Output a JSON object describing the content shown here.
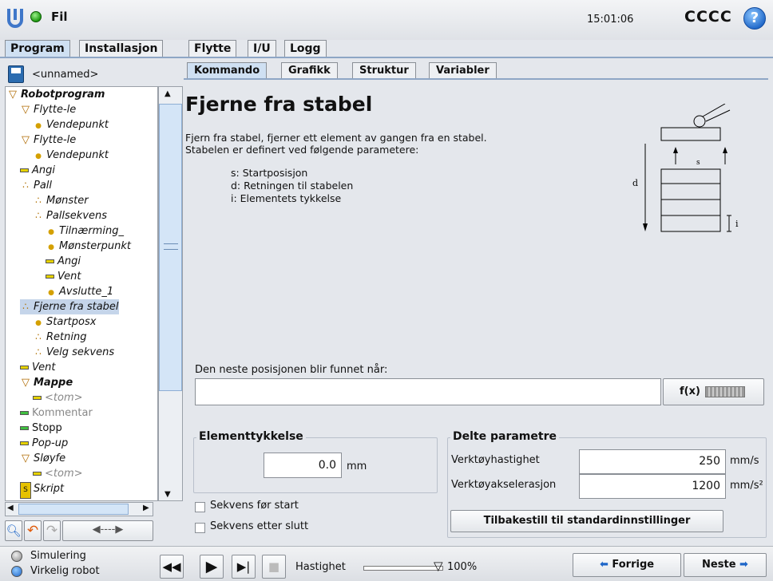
{
  "header": {
    "file_menu": "Fil",
    "clock": "15:01:06",
    "robot_name": "CCCC",
    "help": "?"
  },
  "main_tabs": [
    "Program",
    "Installasjon",
    "Flytte",
    "I/U",
    "Logg"
  ],
  "program": {
    "name": "<unnamed>"
  },
  "tree": [
    {
      "label": "Robotprogram",
      "icon": "triangle",
      "level": 0,
      "bold": true
    },
    {
      "label": "Flytte-le",
      "icon": "triangle",
      "level": 1
    },
    {
      "label": "Vendepunkt",
      "icon": "point",
      "level": 2
    },
    {
      "label": "Flytte-le",
      "icon": "triangle",
      "level": 1
    },
    {
      "label": "Vendepunkt",
      "icon": "point",
      "level": 2
    },
    {
      "label": "Angi",
      "icon": "line",
      "level": 1
    },
    {
      "label": "Pall",
      "icon": "dots",
      "level": 1
    },
    {
      "label": "Mønster",
      "icon": "dots",
      "level": 2
    },
    {
      "label": "Pallsekvens",
      "icon": "dots",
      "level": 2
    },
    {
      "label": "Tilnærming_",
      "icon": "point",
      "level": 3
    },
    {
      "label": "Mønsterpunkt",
      "icon": "point",
      "level": 3
    },
    {
      "label": "Angi",
      "icon": "line",
      "level": 3
    },
    {
      "label": "Vent",
      "icon": "line",
      "level": 3
    },
    {
      "label": "Avslutte_1",
      "icon": "point",
      "level": 3
    },
    {
      "label": "Fjerne fra stabel",
      "icon": "dots",
      "level": 1,
      "selected": true
    },
    {
      "label": "Startposx",
      "icon": "point",
      "level": 2
    },
    {
      "label": "Retning",
      "icon": "dots",
      "level": 2
    },
    {
      "label": "Velg sekvens",
      "icon": "dots",
      "level": 2
    },
    {
      "label": "Vent",
      "icon": "line",
      "level": 1
    },
    {
      "label": "Mappe",
      "icon": "triangle",
      "level": 1,
      "bold": true
    },
    {
      "label": "<tom>",
      "icon": "line",
      "level": 2,
      "grey": true
    },
    {
      "label": "Kommentar",
      "icon": "linegreen",
      "level": 1,
      "grey": true,
      "normal": true
    },
    {
      "label": "Stopp",
      "icon": "linegreen",
      "level": 1,
      "normal": true
    },
    {
      "label": "Pop-up",
      "icon": "line",
      "level": 1
    },
    {
      "label": "Sløyfe",
      "icon": "triangle",
      "level": 1
    },
    {
      "label": "<tom>",
      "icon": "line",
      "level": 2,
      "grey": true
    },
    {
      "label": "Skript",
      "icon": "script",
      "level": 1
    }
  ],
  "sub_tabs": [
    "Kommando",
    "Grafikk",
    "Struktur",
    "Variabler"
  ],
  "command": {
    "title": "Fjerne fra stabel",
    "desc1": "Fjern fra stabel, fjerner ett element av gangen fra en stabel.",
    "desc2": "Stabelen er definert ved følgende parametere:",
    "param_s": "s: Startposisjon",
    "param_d": "d: Retningen til stabelen",
    "param_i": "i: Elementets tykkelse",
    "next_label": "Den neste posisjonen blir funnet når:",
    "expression": "",
    "fx_label": "f(x)"
  },
  "diagram": {
    "d": "d",
    "s": "s",
    "i": "i"
  },
  "thickness": {
    "title": "Elementtykkelse",
    "value": "0.0",
    "unit": "mm"
  },
  "checkboxes": {
    "before": "Sekvens før start",
    "after": "Sekvens etter slutt"
  },
  "shared": {
    "title": "Delte parametre",
    "speed_label": "Verktøyhastighet",
    "speed_value": "250",
    "speed_unit": "mm/s",
    "accel_label": "Verktøyakselerasjon",
    "accel_value": "1200",
    "accel_unit": "mm/s²",
    "reset": "Tilbakestill til standardinnstillinger"
  },
  "bottom": {
    "sim": "Simulering",
    "real": "Virkelig robot",
    "speed_label": "Hastighet",
    "speed_value": "100%",
    "prev": "Forrige",
    "next": "Neste"
  }
}
